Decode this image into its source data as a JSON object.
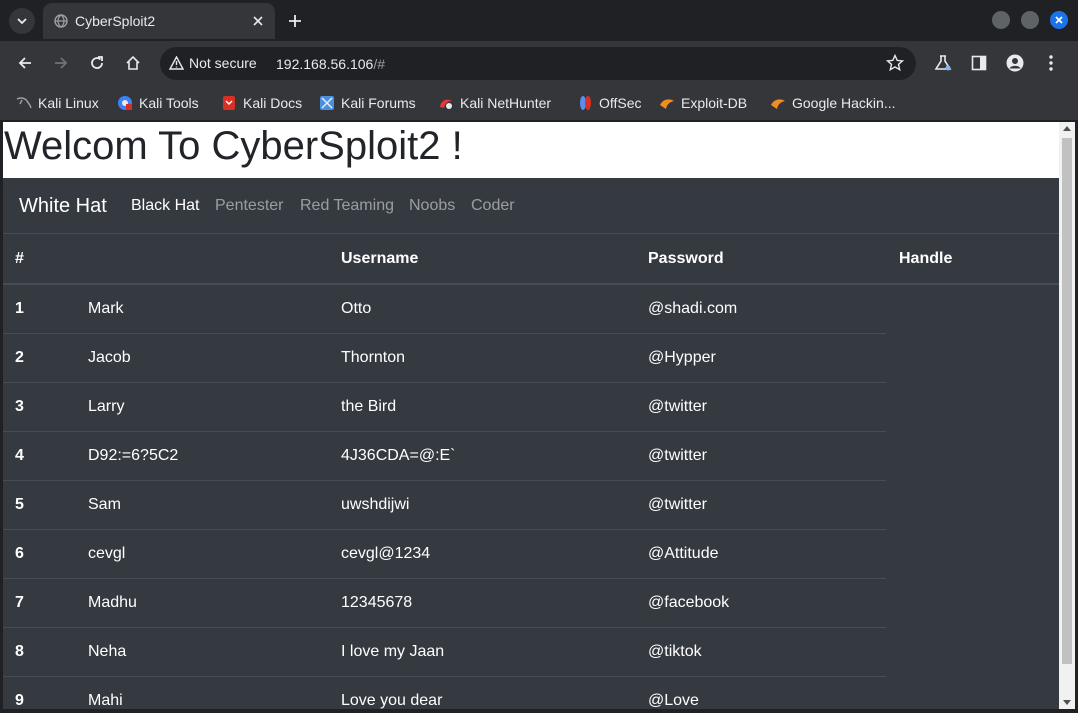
{
  "browser": {
    "tab_title": "CyberSploit2",
    "security_label": "Not secure",
    "url_host": "192.168.56.106",
    "url_path": "/#"
  },
  "bookmarks": [
    {
      "label": "Kali Linux",
      "icon": "kali-dragon-icon",
      "color": "#9aa0a6"
    },
    {
      "label": "Kali Tools",
      "icon": "kali-tools-icon",
      "color": "#3b82f6"
    },
    {
      "label": "Kali Docs",
      "icon": "kali-docs-icon",
      "color": "#d93025"
    },
    {
      "label": "Kali Forums",
      "icon": "kali-forums-icon",
      "color": "#4a90e2"
    },
    {
      "label": "Kali NetHunter",
      "icon": "kali-nethunter-icon",
      "color": "#e53935"
    },
    {
      "label": "OffSec",
      "icon": "offsec-icon",
      "color": "#5b8def"
    },
    {
      "label": "Exploit-DB",
      "icon": "exploit-db-icon",
      "color": "#f28b20"
    },
    {
      "label": "Google Hackin...",
      "icon": "ghdb-icon",
      "color": "#f28b20"
    }
  ],
  "page": {
    "heading": "Welcom To CyberSploit2 !",
    "brand": "White Hat",
    "nav_links": [
      "Black Hat",
      "Pentester",
      "Red Teaming",
      "Noobs",
      "Coder"
    ],
    "active_nav": "Black Hat"
  },
  "table": {
    "headers": [
      "#",
      "Username",
      "Password",
      "Handle"
    ],
    "rows": [
      {
        "num": "1",
        "first": "Mark",
        "second": "Otto",
        "third": "@shadi.com"
      },
      {
        "num": "2",
        "first": "Jacob",
        "second": "Thornton",
        "third": "@Hypper"
      },
      {
        "num": "3",
        "first": "Larry",
        "second": "the Bird",
        "third": "@twitter"
      },
      {
        "num": "4",
        "first": "D92:=6?5C2",
        "second": "4J36CDA=@:E`",
        "third": "@twitter"
      },
      {
        "num": "5",
        "first": "Sam",
        "second": "uwshdijwi",
        "third": "@twitter"
      },
      {
        "num": "6",
        "first": "cevgl",
        "second": "cevgl@1234",
        "third": "@Attitude"
      },
      {
        "num": "7",
        "first": "Madhu",
        "second": "12345678",
        "third": "@facebook"
      },
      {
        "num": "8",
        "first": "Neha",
        "second": "I love my Jaan",
        "third": "@tiktok"
      },
      {
        "num": "9",
        "first": "Mahi",
        "second": "Love you dear",
        "third": "@Love"
      }
    ]
  },
  "colors": {
    "page_bg": "#343a40",
    "border": "#454d55",
    "accent": "#1a73e8"
  }
}
